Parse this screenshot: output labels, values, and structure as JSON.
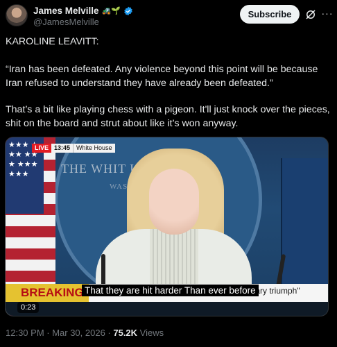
{
  "author": {
    "name": "James Melville",
    "handle": "@JamesMelville",
    "name_emoji": "🚜🌱"
  },
  "header": {
    "subscribe_label": "Subscribe",
    "more_label": "···"
  },
  "post": {
    "line1": "KAROLINE LEAVITT:",
    "quote": "“Iran has been defeated. Any violence beyond this point will be because Iran refused to understand they have already been defeated.”",
    "comment": "That’s a bit like playing chess with a pigeon. It'll just knock over the pieces, shit on the board and strut about like it’s won anyway."
  },
  "video": {
    "live_label": "LIVE",
    "time_label": "13:45",
    "location_label": "White House",
    "backdrop_line1": "THE WHIT        USE",
    "backdrop_line2": "WASHI",
    "flag_stars": "★★★ ★★★ ★★★ ★★★ ★★★",
    "breaking_label": "BREAKING NE",
    "caption": "That they are hit harder Than ever before",
    "ticker": "military triumph\"",
    "duration": "0:23"
  },
  "meta": {
    "timestamp": "12:30 PM · Mar 30, 2026 · ",
    "views_count": "75.2K",
    "views_label": " Views"
  },
  "colors": {
    "background": "#000000",
    "verified_blue": "#1d9bf0",
    "breaking_red": "#b60d14",
    "breaking_yellow": "#e5c230"
  }
}
